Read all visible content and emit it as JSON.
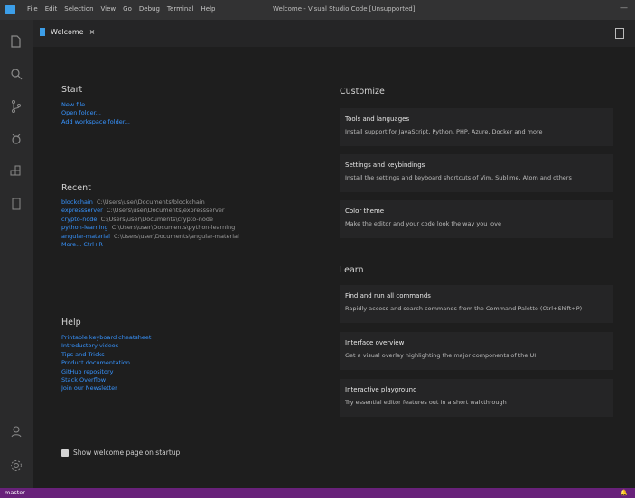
{
  "window": {
    "title": "Welcome - Visual Studio Code [Unsupported]",
    "menu": [
      "File",
      "Edit",
      "Selection",
      "View",
      "Go",
      "Debug",
      "Terminal",
      "Help"
    ]
  },
  "tab": {
    "label": "Welcome",
    "close": "×"
  },
  "start": {
    "title": "Start",
    "items": [
      "New file",
      "Open folder...",
      "Add workspace folder..."
    ]
  },
  "recent": {
    "title": "Recent",
    "items": [
      {
        "name": "blockchain",
        "path": "C:\\Users\\user\\Documents\\blockchain"
      },
      {
        "name": "expressserver",
        "path": "C:\\Users\\user\\Documents\\expressserver"
      },
      {
        "name": "crypto-node",
        "path": "C:\\Users\\user\\Documents\\crypto-node"
      },
      {
        "name": "python-learning",
        "path": "C:\\Users\\user\\Documents\\python-learning"
      },
      {
        "name": "angular-material",
        "path": "C:\\Users\\user\\Documents\\angular-material"
      }
    ],
    "more": "More...   Ctrl+R"
  },
  "help": {
    "title": "Help",
    "items": [
      "Printable keyboard cheatsheet",
      "Introductory videos",
      "Tips and Tricks",
      "Product documentation",
      "GitHub repository",
      "Stack Overflow",
      "Join our Newsletter"
    ]
  },
  "customize": {
    "title": "Customize",
    "cards": [
      {
        "title": "Tools and languages",
        "desc": "Install support for JavaScript, Python, PHP, Azure, Docker and more"
      },
      {
        "title": "Settings and keybindings",
        "desc": "Install the settings and keyboard shortcuts of Vim, Sublime, Atom and others"
      },
      {
        "title": "Color theme",
        "desc": "Make the editor and your code look the way you love"
      }
    ]
  },
  "learn": {
    "title": "Learn",
    "cards": [
      {
        "title": "Find and run all commands",
        "desc": "Rapidly access and search commands from the Command Palette (Ctrl+Shift+P)"
      },
      {
        "title": "Interface overview",
        "desc": "Get a visual overlay highlighting the major components of the UI"
      },
      {
        "title": "Interactive playground",
        "desc": "Try essential editor features out in a short walkthrough"
      }
    ]
  },
  "startup": {
    "label": "Show welcome page on startup",
    "checked": true
  },
  "status": {
    "left": "master",
    "right": "🔔"
  },
  "colors": {
    "accent": "#3794ff",
    "statusbar": "#68217a"
  },
  "icons": [
    "explorer-icon",
    "search-icon",
    "source-control-icon",
    "debug-icon",
    "extensions-icon",
    "remote-icon",
    "account-icon",
    "settings-gear-icon"
  ]
}
